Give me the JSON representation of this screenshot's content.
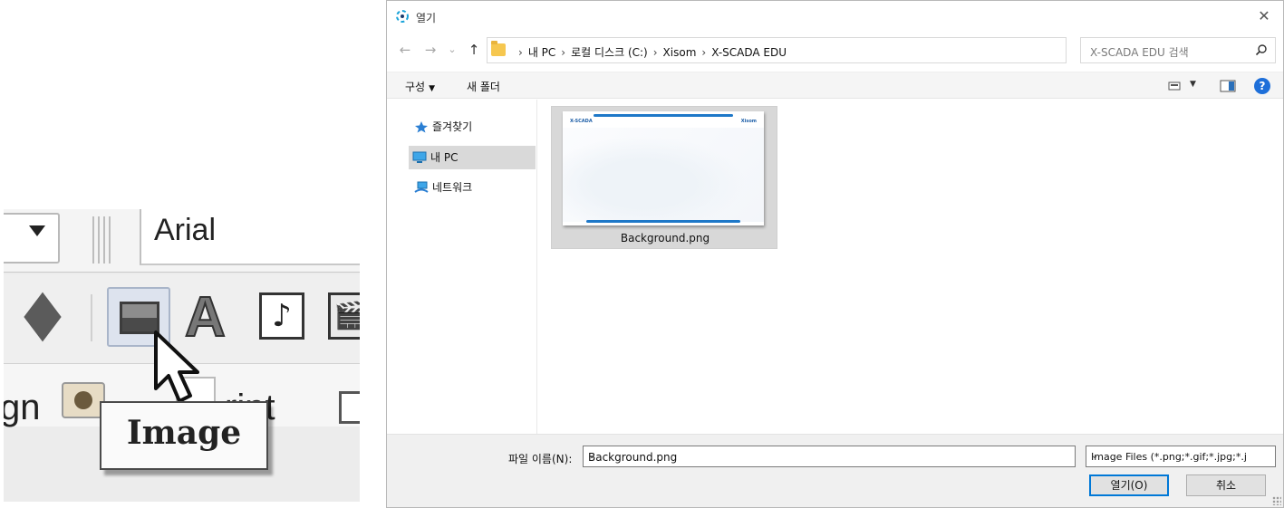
{
  "zoom_toolbar": {
    "font_name": "Arial",
    "tab_left_fragment": "gn",
    "tab_right_fragment": "ript",
    "tooltip": "Image",
    "icons": [
      "dropdown-arrow-icon",
      "grip-icon",
      "diamond-shape-icon",
      "image-icon",
      "text-a-icon",
      "music-note-icon",
      "video-clapper-icon",
      "eye-icon",
      "script-icon",
      "mouse-pointer-icon"
    ]
  },
  "dialog": {
    "title": "열기",
    "close_glyph": "✕",
    "nav": {
      "back": "←",
      "forward": "→",
      "recent": "⌄",
      "up": "↑"
    },
    "address": {
      "breadcrumb": [
        "내 PC",
        "로컬 디스크 (C:)",
        "Xisom",
        "X-SCADA EDU"
      ],
      "separator": "›",
      "dropdown": "⌄",
      "refresh": "↻"
    },
    "search": {
      "placeholder": "X-SCADA EDU 검색"
    },
    "commandbar": {
      "organize": "구성",
      "organize_caret": "▼",
      "new_folder": "새 폴더",
      "view_caret": "▼",
      "help": "?"
    },
    "nav_pane": [
      {
        "label": "즐겨찾기",
        "icon": "star-icon",
        "selected": false
      },
      {
        "label": "내 PC",
        "icon": "computer-icon",
        "selected": true
      },
      {
        "label": "네트워크",
        "icon": "network-icon",
        "selected": false
      }
    ],
    "files": [
      {
        "name": "Background.png",
        "selected": true,
        "thumb_logo_left": "X-SCADA",
        "thumb_logo_right": "Xisom"
      }
    ],
    "footer": {
      "filename_label": "파일 이름(N):",
      "filename_value": "Background.png",
      "filetype_value": "Image Files (*.png;*.gif;*.jpg;*.j",
      "dropdown_glyph": "⌄",
      "open_button": "열기(O)",
      "cancel_button": "취소"
    }
  },
  "colors": {
    "accent": "#0078d7",
    "selection": "#d9d9d9",
    "folder": "#f6c74f",
    "help": "#1e6fd9"
  }
}
